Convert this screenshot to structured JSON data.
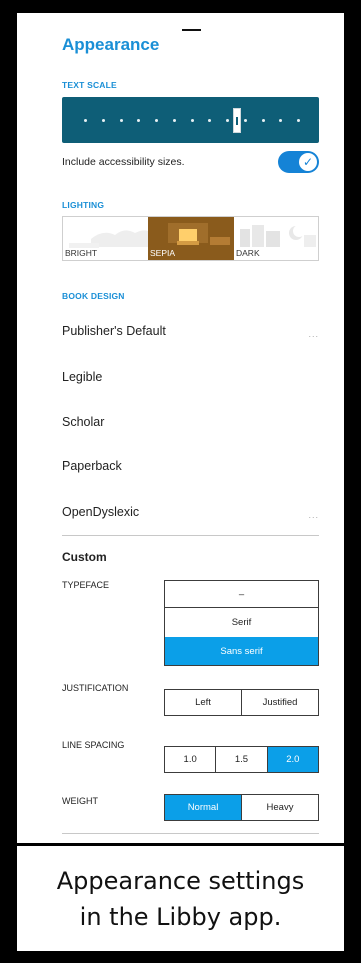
{
  "header": {
    "title": "Appearance"
  },
  "text_scale": {
    "label": "TEXT SCALE",
    "level": 0.72
  },
  "accessibility": {
    "label": "Include accessibility sizes.",
    "toggle_on": true,
    "check_glyph": "✓"
  },
  "lighting": {
    "label": "LIGHTING",
    "options": [
      {
        "label": "BRIGHT",
        "selected": false
      },
      {
        "label": "SEPIA",
        "selected": true
      },
      {
        "label": "DARK",
        "selected": false
      }
    ]
  },
  "book_design": {
    "label": "BOOK DESIGN",
    "items": [
      {
        "label": "Publisher's Default",
        "more": "..."
      },
      {
        "label": "Legible"
      },
      {
        "label": "Scholar"
      },
      {
        "label": "Paperback"
      },
      {
        "label": "OpenDyslexic",
        "more": "..."
      }
    ]
  },
  "custom": {
    "title": "Custom",
    "typeface": {
      "label": "TYPEFACE",
      "options": [
        "–",
        "Serif",
        "Sans serif"
      ],
      "selected": 2
    },
    "justification": {
      "label": "JUSTIFICATION",
      "options": [
        "Left",
        "Justified"
      ]
    },
    "line_spacing": {
      "label": "LINE SPACING",
      "options": [
        "1.0",
        "1.5",
        "2.0"
      ],
      "selected": 2
    },
    "weight": {
      "label": "WEIGHT",
      "options": [
        "Normal",
        "Heavy"
      ],
      "selected": 0
    }
  },
  "caption": {
    "line1": "Appearance settings",
    "line2": "in the Libby app."
  },
  "colors": {
    "accent": "#1a8fd6",
    "selected": "#0b9fe8",
    "slider_bg": "#0e5e77",
    "sepia": "#8a5b1c",
    "toggle": "#1583d6"
  },
  "icons": {
    "toggle": "checkmark-icon",
    "more": "ellipsis-icon",
    "scale_thumb": "slider-thumb-icon"
  }
}
